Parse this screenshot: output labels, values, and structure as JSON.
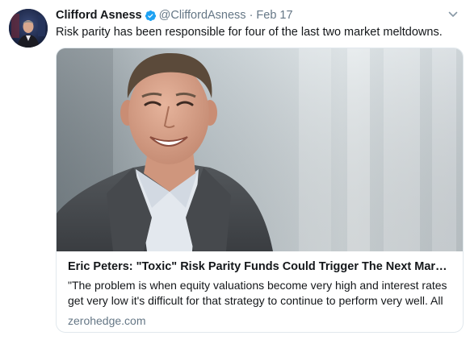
{
  "tweet": {
    "author_name": "Clifford Asness",
    "handle": "@CliffordAsness",
    "separator": "·",
    "date": "Feb 17",
    "text": "Risk parity has been responsible for four of the last two market meltdowns.",
    "icons": {
      "verified": "verified-badge-icon",
      "menu": "chevron-down-icon"
    },
    "colors": {
      "verified": "#1da1f2",
      "secondary_text": "#657786",
      "border": "#e1e8ed"
    }
  },
  "card": {
    "title": "Eric Peters: \"Toxic\" Risk Parity Funds Could Trigger The Next Market...",
    "description": "\"The problem is when equity valuations become very high and interest rates get very low it's difficult for that strategy to continue to perform very well. All",
    "domain": "zerohedge.com"
  }
}
